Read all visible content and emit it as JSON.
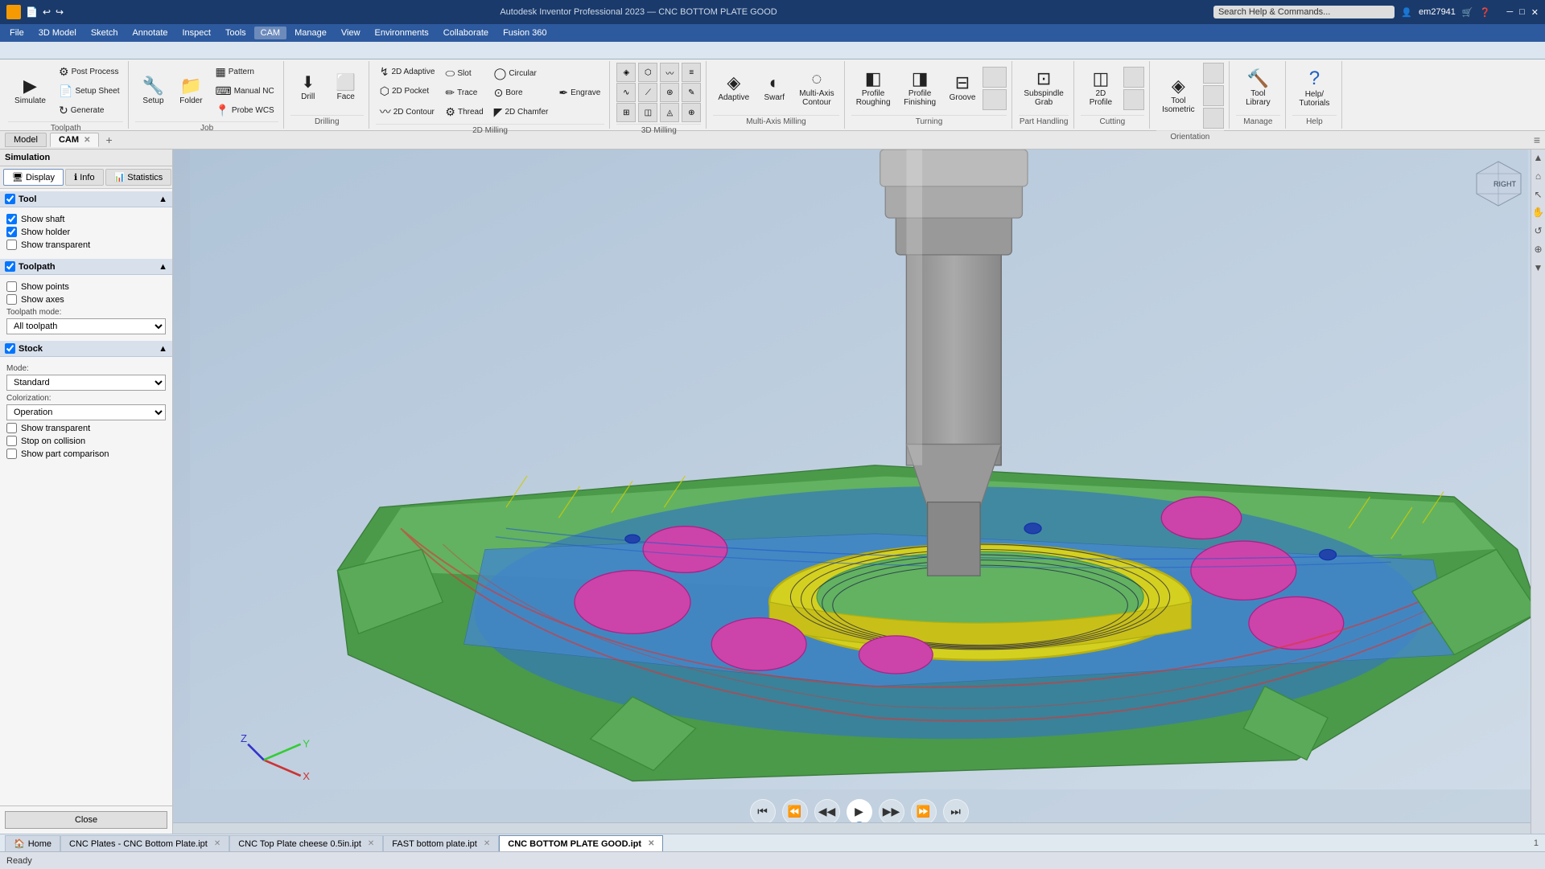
{
  "titlebar": {
    "app_name": "Autodesk Inventor Professional 2023",
    "file_name": "CNC BOTTOM PLATE GOOD",
    "search_placeholder": "Search Help & Commands...",
    "user": "em27941",
    "window_controls": [
      "─",
      "□",
      "✕"
    ]
  },
  "menubar": {
    "items": [
      "File",
      "3D Model",
      "Sketch",
      "Annotate",
      "Inspect",
      "Tools",
      "CAM",
      "Manage",
      "View",
      "Environments",
      "Collaborate",
      "Fusion 360"
    ]
  },
  "ribbon": {
    "active_tab": "CAM",
    "tabs": [
      "File",
      "3D Model",
      "Sketch",
      "Annotate",
      "Inspect",
      "Tools",
      "CAM",
      "Manage",
      "View",
      "Environments",
      "Collaborate",
      "Fusion 360"
    ],
    "groups": {
      "toolpath": {
        "label": "Toolpath",
        "items": [
          {
            "id": "simulate",
            "icon": "▶",
            "label": "Simulate",
            "large": true
          },
          {
            "id": "post_process",
            "icon": "⚙",
            "label": "Post Process"
          },
          {
            "id": "setup_sheet",
            "icon": "📄",
            "label": "Setup Sheet"
          },
          {
            "id": "generate",
            "icon": "↻",
            "label": "Generate"
          }
        ]
      },
      "job": {
        "label": "Job",
        "items": [
          {
            "id": "setup",
            "icon": "🔧",
            "label": "Setup"
          },
          {
            "id": "folder",
            "icon": "📁",
            "label": "Folder"
          },
          {
            "id": "pattern",
            "icon": "▦",
            "label": "Pattern"
          },
          {
            "id": "manual_nc",
            "icon": "⌨",
            "label": "Manual NC"
          },
          {
            "id": "probe_wcs",
            "icon": "📍",
            "label": "Probe WCS"
          }
        ]
      },
      "drilling": {
        "label": "Drilling",
        "items": [
          {
            "id": "drill",
            "icon": "⬇",
            "label": "Drill"
          },
          {
            "id": "face",
            "icon": "⬜",
            "label": "Face"
          }
        ]
      },
      "milling_2d": {
        "label": "2D Milling",
        "items": [
          {
            "id": "adaptive_2d",
            "icon": "↯",
            "label": "2D Adaptive"
          },
          {
            "id": "pocket_2d",
            "icon": "⬡",
            "label": "2D Pocket"
          },
          {
            "id": "contour_2d",
            "icon": "〰",
            "label": "2D Contour"
          },
          {
            "id": "slot",
            "icon": "⬭",
            "label": "Slot"
          },
          {
            "id": "trace",
            "icon": "✏",
            "label": "Trace"
          },
          {
            "id": "thread",
            "icon": "⚙",
            "label": "Thread"
          },
          {
            "id": "circular",
            "icon": "◯",
            "label": "Circular"
          },
          {
            "id": "bore",
            "icon": "⊙",
            "label": "Bore"
          },
          {
            "id": "chamfer_2d",
            "icon": "◤",
            "label": "2D Chamfer"
          },
          {
            "id": "engrave",
            "icon": "✒",
            "label": "Engrave"
          }
        ]
      },
      "milling_3d": {
        "label": "3D Milling",
        "items": []
      },
      "multi_axis": {
        "label": "Multi-Axis Milling",
        "items": [
          {
            "id": "adaptive",
            "icon": "◈",
            "label": "Adaptive"
          },
          {
            "id": "swarf",
            "icon": "◐",
            "label": "Swarf"
          },
          {
            "id": "multi_axis_contour",
            "icon": "◌",
            "label": "Multi-Axis Contour"
          }
        ]
      },
      "turning": {
        "label": "Turning",
        "items": [
          {
            "id": "profile_roughing",
            "icon": "◧",
            "label": "Profile Roughing"
          },
          {
            "id": "profile_finishing",
            "icon": "◨",
            "label": "Profile Finishing"
          },
          {
            "id": "groove",
            "icon": "⊟",
            "label": "Groove"
          }
        ]
      },
      "part_handling": {
        "label": "Part Handling",
        "items": [
          {
            "id": "subspindle_grab",
            "icon": "⊡",
            "label": "Subspindle Grab"
          }
        ]
      },
      "cutting": {
        "label": "Cutting",
        "items": [
          {
            "id": "profile_2d",
            "icon": "◫",
            "label": "2D Profile"
          }
        ]
      },
      "orientation": {
        "label": "Orientation",
        "items": [
          {
            "id": "tool_isometric",
            "icon": "◈",
            "label": "Tool Isometric"
          }
        ]
      },
      "manage": {
        "label": "Manage",
        "items": [
          {
            "id": "tool_library",
            "icon": "🔨",
            "label": "Tool Library"
          }
        ]
      },
      "help": {
        "label": "Help",
        "items": [
          {
            "id": "help_tutorials",
            "icon": "?",
            "label": "Help/Tutorials"
          }
        ]
      }
    }
  },
  "left_panel": {
    "model_tabs": [
      "Model",
      "CAM",
      "+"
    ],
    "panel_header": "Simulation",
    "tabs": [
      "Display",
      "Info",
      "Statistics"
    ],
    "active_tab": "Display",
    "sections": {
      "tool": {
        "title": "Tool",
        "checked": true,
        "items": [
          {
            "id": "show_shaft",
            "label": "Show shaft",
            "checked": true
          },
          {
            "id": "show_holder",
            "label": "Show holder",
            "checked": true
          },
          {
            "id": "show_transparent",
            "label": "Show transparent",
            "checked": false
          }
        ]
      },
      "toolpath": {
        "title": "Toolpath",
        "checked": true,
        "items": [
          {
            "id": "show_points",
            "label": "Show points",
            "checked": false
          },
          {
            "id": "show_axes",
            "label": "Show axes",
            "checked": false
          }
        ],
        "mode_label": "Toolpath mode:",
        "mode_options": [
          "All toolpath"
        ],
        "mode_selected": "All toolpath"
      },
      "stock": {
        "title": "Stock",
        "checked": true,
        "items": [
          {
            "id": "show_transparent_stock",
            "label": "Show transparent",
            "checked": false
          },
          {
            "id": "stop_on_collision",
            "label": "Stop on collision",
            "checked": false
          },
          {
            "id": "show_part_comparison",
            "label": "Show part comparison",
            "checked": false
          }
        ],
        "mode_label": "Mode:",
        "mode_options": [
          "Standard"
        ],
        "mode_selected": "Standard",
        "colorization_label": "Colorization:",
        "colorization_options": [
          "Operation"
        ],
        "colorization_selected": "Operation"
      }
    }
  },
  "viewport": {
    "background_start": "#b8c8d8",
    "background_end": "#d0dce8"
  },
  "playback": {
    "buttons": [
      {
        "id": "goto_start",
        "icon": "⏮",
        "label": "Go to start"
      },
      {
        "id": "prev_op",
        "icon": "⏪",
        "label": "Previous operation"
      },
      {
        "id": "prev_step",
        "icon": "◀◀",
        "label": "Previous step"
      },
      {
        "id": "play",
        "icon": "▶",
        "label": "Play"
      },
      {
        "id": "next_step",
        "icon": "▶▶",
        "label": "Next step"
      },
      {
        "id": "next_op",
        "icon": "⏩",
        "label": "Next operation"
      },
      {
        "id": "goto_end",
        "icon": "⏭",
        "label": "Go to end"
      }
    ],
    "progress": 55
  },
  "document_tabs": [
    {
      "label": "Home",
      "active": false,
      "closeable": false
    },
    {
      "label": "CNC Plates - CNC Bottom Plate.ipt",
      "active": false,
      "closeable": true
    },
    {
      "label": "CNC Top Plate cheese 0.5in.ipt",
      "active": false,
      "closeable": true
    },
    {
      "label": "FAST bottom plate.ipt",
      "active": false,
      "closeable": true
    },
    {
      "label": "CNC BOTTOM PLATE GOOD.ipt",
      "active": true,
      "closeable": true
    }
  ],
  "statusbar": {
    "status": "Ready",
    "page_count": "1"
  },
  "close_button": {
    "label": "Close"
  }
}
